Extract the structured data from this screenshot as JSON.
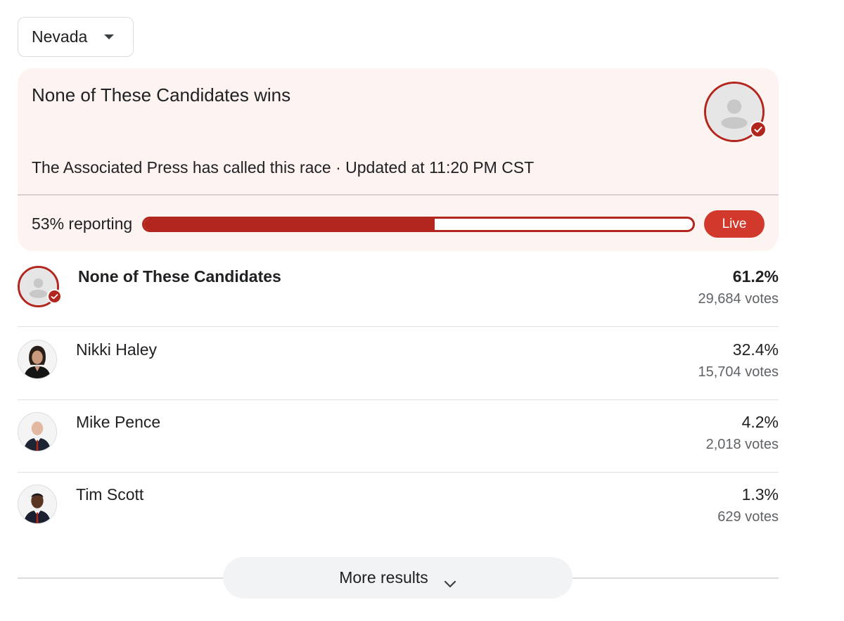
{
  "state_selector": {
    "value": "Nevada",
    "icon": "arrow-drop-down-icon"
  },
  "winner_card": {
    "title": "None of These Candidates wins",
    "call_status": "The Associated Press has called this race · Updated at 11:20 PM CST",
    "reporting_label": "53% reporting",
    "reporting_fraction": 0.53,
    "live_label": "Live",
    "winner_avatar_icon": "person-placeholder-icon",
    "winner_badge_icon": "check-icon"
  },
  "colors": {
    "accent": "#b3261e",
    "live_badge": "#d0392b",
    "card_background": "#fdf3f0"
  },
  "candidates": [
    {
      "name": "None of These Candidates",
      "percent": "61.2%",
      "votes": "29,684 votes",
      "winner": true,
      "avatar": "person-placeholder-icon"
    },
    {
      "name": "Nikki Haley",
      "percent": "32.4%",
      "votes": "15,704 votes",
      "winner": false,
      "avatar": "candidate-photo"
    },
    {
      "name": "Mike Pence",
      "percent": "4.2%",
      "votes": "2,018 votes",
      "winner": false,
      "avatar": "candidate-photo"
    },
    {
      "name": "Tim Scott",
      "percent": "1.3%",
      "votes": "629 votes",
      "winner": false,
      "avatar": "candidate-photo"
    }
  ],
  "more_results": {
    "label": "More results",
    "icon": "chevron-down-icon"
  }
}
